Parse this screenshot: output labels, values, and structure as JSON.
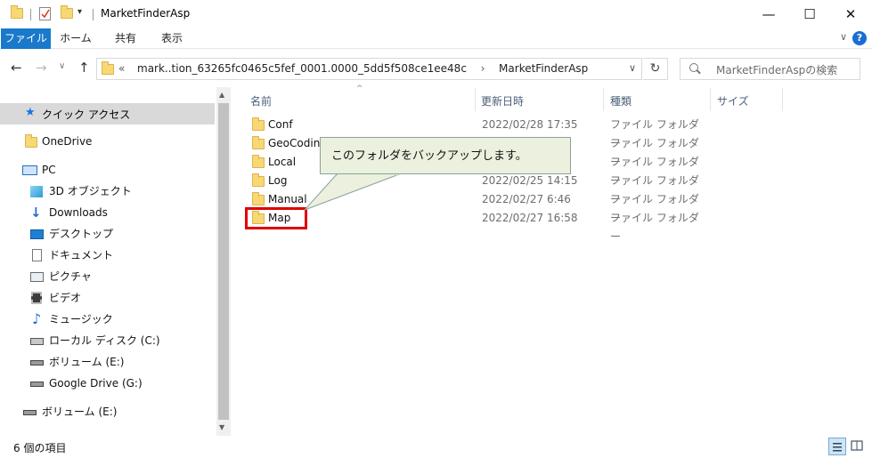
{
  "window": {
    "title": "MarketFinderAsp",
    "minimize_glyph": "—",
    "maximize_glyph": "☐",
    "close_glyph": "✕"
  },
  "ribbon": {
    "tabs": [
      "ファイル",
      "ホーム",
      "共有",
      "表示"
    ],
    "help_glyph": "?",
    "collapse_glyph": "∨"
  },
  "nav": {
    "back_glyph": "←",
    "forward_glyph": "→",
    "recent_glyph": "∨",
    "up_glyph": "↑"
  },
  "address": {
    "chevron": "«",
    "path_segment": "mark..tion_63265fc0465c5fef_0001.0000_5dd5f508ce1ee48c",
    "separator": "›",
    "current": "MarketFinderAsp",
    "dropdown_glyph": "∨",
    "refresh_glyph": "↻"
  },
  "search": {
    "placeholder": "MarketFinderAspの検索"
  },
  "navpane": {
    "quick_access": "クイック アクセス",
    "onedrive": "OneDrive",
    "pc": "PC",
    "items": [
      {
        "label": "3D オブジェクト",
        "icon": "3d-objects-icon"
      },
      {
        "label": "Downloads",
        "icon": "downloads-icon"
      },
      {
        "label": "デスクトップ",
        "icon": "desktop-icon"
      },
      {
        "label": "ドキュメント",
        "icon": "documents-icon"
      },
      {
        "label": "ピクチャ",
        "icon": "pictures-icon"
      },
      {
        "label": "ビデオ",
        "icon": "videos-icon"
      },
      {
        "label": "ミュージック",
        "icon": "music-icon"
      },
      {
        "label": "ローカル ディスク (C:)",
        "icon": "local-disk-icon"
      },
      {
        "label": "ボリューム (E:)",
        "icon": "drive-icon"
      },
      {
        "label": "Google Drive (G:)",
        "icon": "drive-icon"
      }
    ],
    "volume_e": "ボリューム (E:)"
  },
  "columns": {
    "name": "名前",
    "date": "更新日時",
    "type": "種類",
    "size": "サイズ",
    "sort_glyph": "^"
  },
  "files": [
    {
      "name": "Conf",
      "date": "2022/02/28 17:35",
      "type": "ファイル フォルダー"
    },
    {
      "name": "GeoCoding",
      "date": "",
      "type": "ファイル フォルダー"
    },
    {
      "name": "Local",
      "date": "",
      "type": "ファイル フォルダー"
    },
    {
      "name": "Log",
      "date": "2022/02/25 14:15",
      "type": "ファイル フォルダー"
    },
    {
      "name": "Manual",
      "date": "2022/02/27 6:46",
      "type": "ファイル フォルダー"
    },
    {
      "name": "Map",
      "date": "2022/02/27 16:58",
      "type": "ファイル フォルダー"
    }
  ],
  "callout": {
    "text": "このフォルダをバックアップします。"
  },
  "status": {
    "item_count": "6 個の項目"
  },
  "colors": {
    "accent": "#1979ca",
    "highlight": "#e00000",
    "callout_bg": "#ebf1de",
    "folder": "#f8d775"
  }
}
